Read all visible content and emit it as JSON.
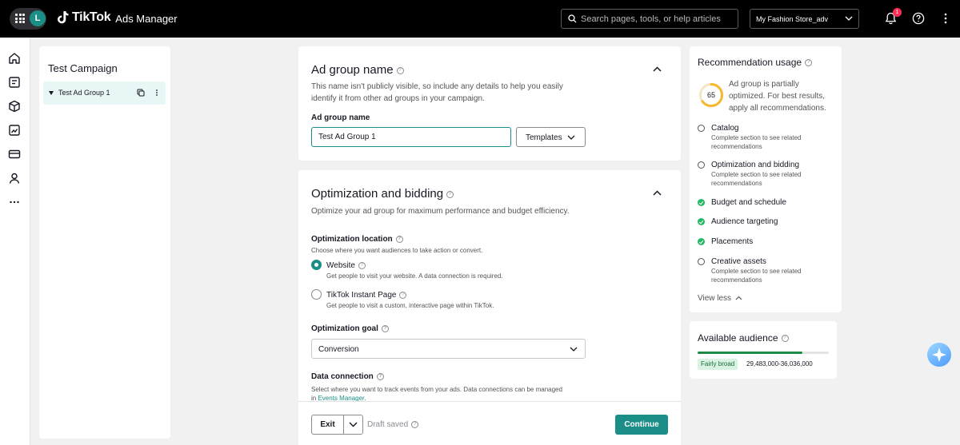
{
  "app": {
    "brand_name": "TikTok",
    "brand_sub": "Ads Manager",
    "avatar_initial": "L",
    "search_placeholder": "Search pages, tools, or help articles",
    "account_name": "My Fashion Store_adv",
    "notification_count": "1"
  },
  "sidebar": {
    "icons": [
      "home-icon",
      "campaign-icon",
      "assets-icon",
      "reporting-icon",
      "payment-icon",
      "user-icon",
      "more-icon"
    ]
  },
  "tree": {
    "campaign_title": "Test Campaign",
    "ad_group_label": "Test Ad Group 1"
  },
  "ad_group_name": {
    "title": "Ad group name",
    "description": "This name isn't publicly visible, so include any details to help you easily identify it from other ad groups in your campaign.",
    "field_label": "Ad group name",
    "field_value": "Test Ad Group 1",
    "templates_label": "Templates"
  },
  "optimization": {
    "title": "Optimization and bidding",
    "description": "Optimize your ad group for maximum performance and budget efficiency.",
    "location_label": "Optimization location",
    "location_sub": "Choose where you want audiences to take action or convert.",
    "options": [
      {
        "title": "Website",
        "sub": "Get people to visit your website. A data connection is required.",
        "selected": true
      },
      {
        "title": "TikTok Instant Page",
        "sub": "Get people to visit a custom, interactive page within TikTok.",
        "selected": false
      }
    ],
    "goal_label": "Optimization goal",
    "goal_value": "Conversion",
    "data_connection_label": "Data connection",
    "data_connection_sub": "Select where you want to track events from your ads. Data connections can be managed in",
    "events_manager_link": "Events Manager",
    "data_connection_end": "."
  },
  "footer": {
    "exit_label": "Exit",
    "draft_status": "Draft saved",
    "continue_label": "Continue"
  },
  "recommendation": {
    "title": "Recommendation usage",
    "score": "65",
    "score_fraction": 0.65,
    "summary": "Ad group is partially optimized. For best results, apply all recommendations.",
    "items": [
      {
        "name": "Catalog",
        "sub": "Complete section to see related recommendations",
        "done": false
      },
      {
        "name": "Optimization and bidding",
        "sub": "Complete section to see related recommendations",
        "done": false
      },
      {
        "name": "Budget and schedule",
        "sub": "",
        "done": true
      },
      {
        "name": "Audience targeting",
        "sub": "",
        "done": true
      },
      {
        "name": "Placements",
        "sub": "",
        "done": true
      },
      {
        "name": "Creative assets",
        "sub": "Complete section to see related recommendations",
        "done": false
      }
    ],
    "view_less_label": "View less"
  },
  "audience": {
    "title": "Available audience",
    "level_fraction": 0.8,
    "badge": "Fairly broad",
    "range": "29,483,000-36,036,000"
  },
  "colors": {
    "brand_teal": "#1a8e87",
    "check_green": "#25b864",
    "score_ring": "#f5b82e",
    "audience_fill": "#1d8a4a"
  }
}
